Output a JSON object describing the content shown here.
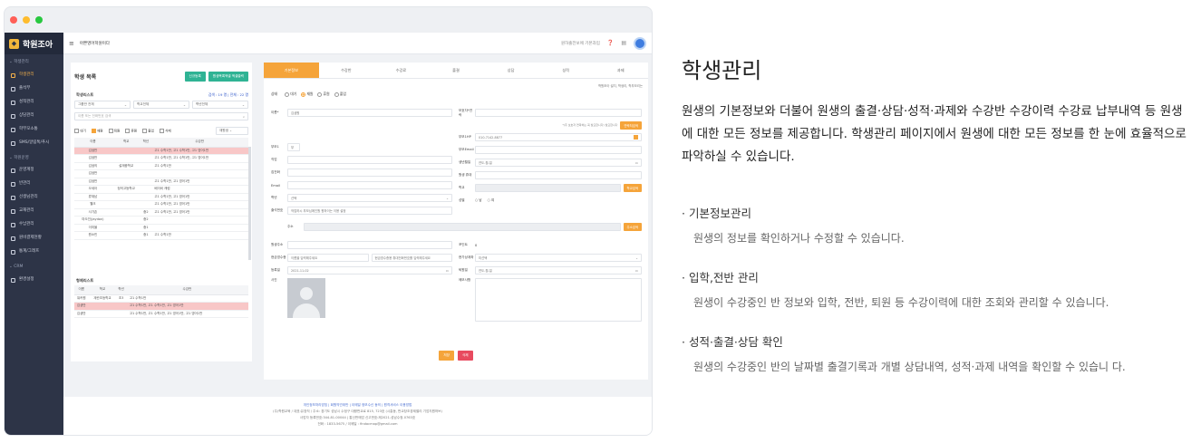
{
  "app": {
    "logo_text": "학원조아",
    "academy_name": "아쁜영어학원이다",
    "topbar_hint": "원하출전보에 기본과입",
    "window_dots": [
      "#ff5f57",
      "#febc2e",
      "#28c840"
    ]
  },
  "sidebar": {
    "groups": [
      {
        "title": "학생관리",
        "items": [
          "학생관리",
          "출석부",
          "성적관리",
          "상담관리",
          "학부모소통",
          "SMS/알림톡/푸시"
        ]
      },
      {
        "title": "학원운영",
        "items": [
          "운영계정",
          "반관리",
          "선생님관리",
          "교재관리",
          "수납관리",
          "원비결제현황",
          "통계/그래프"
        ]
      },
      {
        "title": "CRM",
        "items": [
          "환경설정"
        ]
      }
    ],
    "active": "학생관리"
  },
  "left_panel": {
    "title": "학생 목록",
    "btn_new": "신규등록",
    "btn_bulk": "원생목록엑셀 엑셀출력",
    "list_title": "학생리스트",
    "count_text": "검색 : 19 명 | 전체 : 22 명",
    "filters": [
      "그룹반 전체",
      "학교전체",
      "학년전체"
    ],
    "search_placeholder": "이름 또는 전화번호 검색",
    "status_checks": [
      "대기",
      "재원",
      "퇴원",
      "휴원",
      "졸업",
      "삭제"
    ],
    "status_select": "재원생",
    "columns": [
      "이름",
      "학교",
      "학년",
      "수강반"
    ],
    "rows": [
      [
        "김샘반",
        "",
        "",
        "고1 수학1반, 고1 수학1반, 고1 영어1반"
      ],
      [
        "김샘반",
        "",
        "",
        "고1 수학1반, 고1 수학1반, 고1 영어1반"
      ],
      [
        "김샘의",
        "설재중학교",
        "",
        "고1 수학1반"
      ],
      [
        "김샘반",
        "",
        "",
        ""
      ],
      [
        "김샘반",
        "",
        "",
        "고1 수학1반, 고1 영어1반"
      ],
      [
        "오세아",
        "정의고등학교",
        "",
        "베이비 캐럼"
      ],
      [
        "류재남",
        "",
        "",
        "고1 수학1반, 고1 영어1반"
      ],
      [
        "웰크",
        "",
        "",
        "고1 수학1반, 고1 영어1반"
      ],
      [
        "사기존",
        "",
        "중2",
        "고1 수학1반, 고1 영어1반"
      ],
      [
        "마오진(Jaydon)",
        "",
        "중2",
        ""
      ],
      [
        "이미율",
        "",
        "중1",
        ""
      ],
      [
        "원소빈",
        "",
        "중1",
        "고1 수학1반"
      ]
    ],
    "highlight_rows": [
      0
    ],
    "sibling_title": "형제리스트",
    "sibling_columns": [
      "이름",
      "학교",
      "학년",
      "수강반"
    ],
    "sibling_rows": [
      [
        "워커원",
        "계란초등학교",
        "초3",
        "고1 수학1반"
      ],
      [
        "김샘반",
        "",
        "",
        "고1 수학1반, 고1 수학1반, 고1 영어1반"
      ],
      [
        "김샘반",
        "",
        "",
        "고1 수학1반, 고1 수학1반, 고1 영어1반, 고1 영어1반"
      ]
    ],
    "sibling_highlight": [
      1
    ]
  },
  "right_panel": {
    "tabs": [
      "기본정보",
      "수강반",
      "수강료",
      "출결",
      "상담",
      "성적",
      "과제"
    ],
    "active_tab": "기본정보",
    "note": "학원조아 설치, 학생리, 학부모리는",
    "status_label": "상태",
    "status_options": [
      "대기",
      "재원",
      "휴원",
      "졸업"
    ],
    "status_selected": "재원",
    "fields": {
      "name_label": "이름*",
      "name_value": "김샘원",
      "parent_phone_label": "보호자*연락",
      "phone_notice": "*(주 보호자 연락처는 꼭 필요합니다) 필요합니다",
      "phone_btn": "연락처검색",
      "parent_label": "부모1",
      "parent_value": "부",
      "parent_hp_label": "부모1HP",
      "parent_hp_value": "010-7142-8877",
      "email1_label": "직업",
      "email1_value": "",
      "email2_label": "부모Email",
      "rel_label": "집전화",
      "birth_label": "생년월일",
      "birth_value": "연도-월-일",
      "email_label": "Email",
      "hp_label": "원생 휴대",
      "grade_label": "학년",
      "grade_value": "선택",
      "school_label": "학교",
      "school_btn": "학교검색",
      "address_label": "출석번호",
      "address_value": "작업하시 부모님에인원 원하이는 이용 설정",
      "gender_label": "성별",
      "gender_options": [
        "남",
        "여"
      ],
      "addr2_label": "주소",
      "addr2_btn": "주소검색",
      "note_label": "원생주소",
      "points_label": "포인트",
      "points_value": "0",
      "pay_label": "현금영수증",
      "pay_value": "이름을 입력해주세요",
      "pay_value2": "현금영수증용 휴대전화번호를 입력해주세요",
      "card_label": "현가상계좌",
      "card_value": "미선택",
      "enroll_label": "등록일",
      "enroll_value": "2021-11-02",
      "out_label": "퇴원일",
      "out_value": "연도-월-일",
      "photo_label": "사진",
      "memo_label": "메모사항"
    },
    "save_btn": "저장",
    "delete_btn": "삭제"
  },
  "footer": {
    "links": "개인정보처리방침 | 회원약관위반 | 이메일 정보수신 동의 | 원격서비스 이용방법",
    "line1": "(주)학원교육 / 대표:유창직 / 주소: 경기도 성남시 수정구 대왕판교로 815, 723호 (시흥동, 판교창조경제밸리 기업지원허브)",
    "line2": "사업자 등록번호:344-81-00044 | 통신판매업 신고번호:제2021-성남수정-0763호",
    "line3": "전화 : 1833-5675 / 이메일 : findacmap@gmail.com"
  },
  "description": {
    "heading": "학생관리",
    "lead": "원생의 기본정보와 더불어 원생의 출결·상담·성적·과제와 수강반 수강이력 수강료 납부내역 등 원생에 대한 모든 정보를 제공합니다. 학생관리 페이지에서 원생에 대한 모든 정보를 한 눈에 효율적으로 파악하실 수 있습니다.",
    "features": [
      {
        "title": "기본정보관리",
        "desc": "원생의 정보를 확인하거나 수정할 수 있습니다."
      },
      {
        "title": "입학,전반 관리",
        "desc": "원생이 수강중인 반 정보와 입학, 전반, 퇴원 등 수강이력에 대한 조회와 관리할 수 있습니다."
      },
      {
        "title": "성적·출결·상담 확인",
        "desc": "원생의 수강중인 반의 날짜별 출결기록과 개별 상담내역, 성적·과제 내역을 확인할 수 있습니 다."
      }
    ]
  }
}
